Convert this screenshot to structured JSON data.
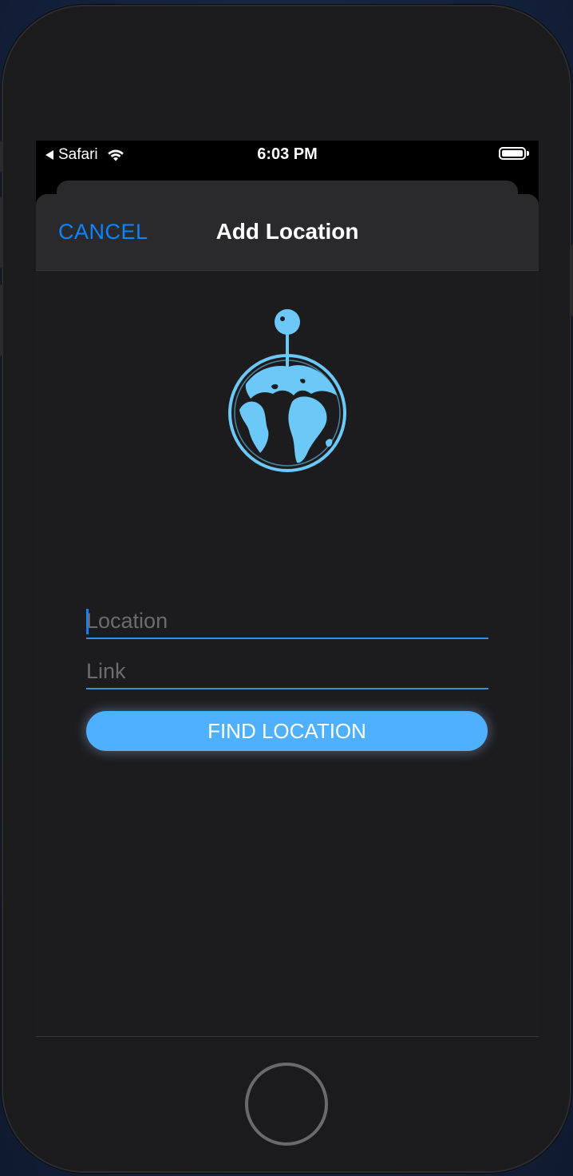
{
  "status_bar": {
    "back_app": "Safari",
    "time": "6:03 PM"
  },
  "nav": {
    "cancel_label": "CANCEL",
    "title": "Add Location"
  },
  "form": {
    "location_placeholder": "Location",
    "location_value": "",
    "link_placeholder": "Link",
    "link_value": "",
    "find_button_label": "FIND LOCATION"
  },
  "icons": {
    "hero": "globe-pin-icon",
    "status_wifi": "wifi-icon",
    "status_battery": "battery-icon",
    "status_back": "back-triangle-icon"
  },
  "colors": {
    "accent": "#0a84ff",
    "button": "#4fb0ff",
    "globe": "#6cc8f7",
    "sheet_bg": "#1c1c1e",
    "nav_bg": "#2a2a2c"
  }
}
